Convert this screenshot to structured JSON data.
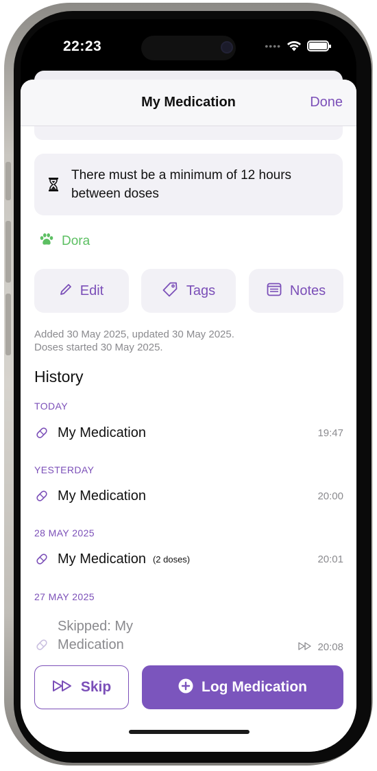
{
  "status_bar": {
    "time": "22:23"
  },
  "nav": {
    "title": "My Medication",
    "done_label": "Done"
  },
  "info": {
    "text": "There must be a minimum of 12 hours between doses",
    "icon": "hourglass-icon"
  },
  "pet": {
    "name": "Dora",
    "icon": "paw-icon"
  },
  "actions": {
    "edit_label": "Edit",
    "tags_label": "Tags",
    "notes_label": "Notes"
  },
  "meta": {
    "line1": "Added 30 May 2025, updated 30 May 2025.",
    "line2": "Doses started 30 May 2025."
  },
  "history": {
    "title": "History",
    "sections": [
      {
        "label": "TODAY",
        "entry": {
          "name": "My Medication",
          "doses": "",
          "time": "19:47"
        }
      },
      {
        "label": "YESTERDAY",
        "entry": {
          "name": "My Medication",
          "doses": "",
          "time": "20:00"
        }
      },
      {
        "label": "28 MAY 2025",
        "entry": {
          "name": "My Medication",
          "doses": "(2 doses)",
          "time": "20:01"
        }
      },
      {
        "label": "27 MAY 2025",
        "entry": {
          "name": "Skipped: My Medication",
          "doses": "",
          "time": "20:08"
        }
      }
    ]
  },
  "buttons": {
    "skip_label": "Skip",
    "log_label": "Log Medication"
  },
  "colors": {
    "accent": "#7b4fb8",
    "pet": "#5cbf62",
    "muted": "#8a8a8e",
    "card": "#f2f1f6"
  }
}
